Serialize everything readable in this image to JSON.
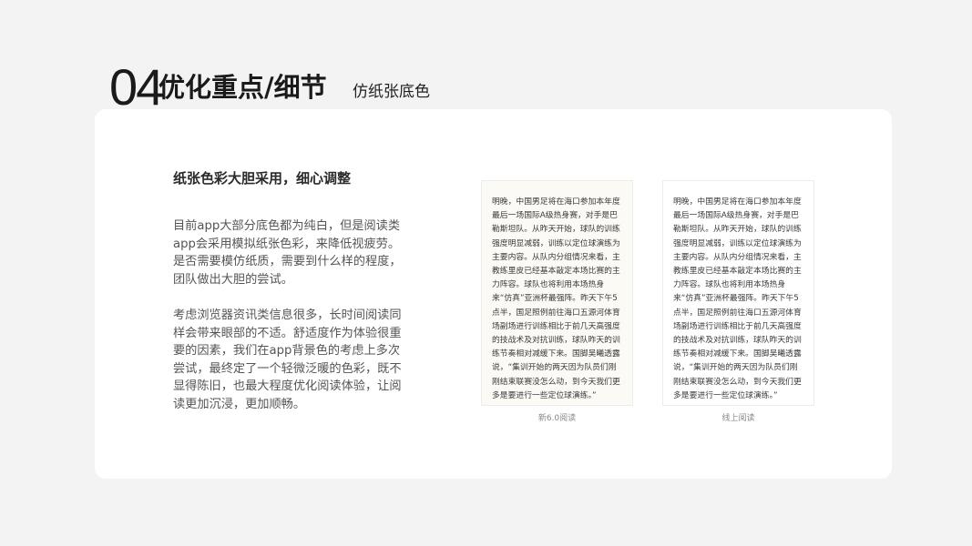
{
  "header": {
    "number": "04",
    "title": "优化重点/细节",
    "subtitle": "仿纸张底色"
  },
  "content": {
    "lead": "纸张色彩大胆采用，细心调整",
    "paragraph1": "目前app大部分底色都为纯白，但是阅读类app会采用模拟纸张色彩，来降低视疲劳。是否需要模仿纸质，需要到什么样的程度，团队做出大胆的尝试。",
    "paragraph2": "考虑浏览器资讯类信息很多，长时间阅读同样会带来眼部的不适。舒适度作为体验很重要的因素，我们在app背景色的考虑上多次尝试，最终定了一个轻微泛暖的色彩，既不显得陈旧，也最大程度优化阅读体验，让阅读更加沉浸，更加顺畅。"
  },
  "samples": [
    {
      "text": "明晚，中国男足将在海口参加本年度最后一场国际A级热身赛，对手是巴勒斯坦队。从昨天开始，球队的训练强度明显减弱，训练以定位球演练为主要内容。从队内分组情况来看，主教练里皮已经基本敲定本场比赛的主力阵容。球队也将利用本场热身来“仿真”亚洲杯最强阵。昨天下午5点半，国足照例前往海口五源河体育场副场进行训练相比于前几天高强度的技战术及对抗训练，球队昨天的训练节奏相对减缓下来。国脚吴曦透露说，“集训开始的两天因为队员们刚刚结束联赛没怎么动，到今天我们更多是要进行一些定位球演练。”",
      "caption": "新6.0阅读",
      "background": "#fcfaf5"
    },
    {
      "text": "明晚，中国男足将在海口参加本年度最后一场国际A级热身赛，对手是巴勒斯坦队。从昨天开始，球队的训练强度明显减弱，训练以定位球演练为主要内容。从队内分组情况来看，主教练里皮已经基本敲定本场比赛的主力阵容。球队也将利用本场热身来“仿真”亚洲杯最强阵。昨天下午5点半，国足照例前往海口五源河体育场副场进行训练相比于前几天高强度的技战术及对抗训练，球队昨天的训练节奏相对减缓下来。国脚吴曦透露说，“集训开始的两天因为队员们刚刚结束联赛没怎么动，到今天我们更多是要进行一些定位球演练。”",
      "caption": "线上阅读",
      "background": "#ffffff"
    }
  ]
}
